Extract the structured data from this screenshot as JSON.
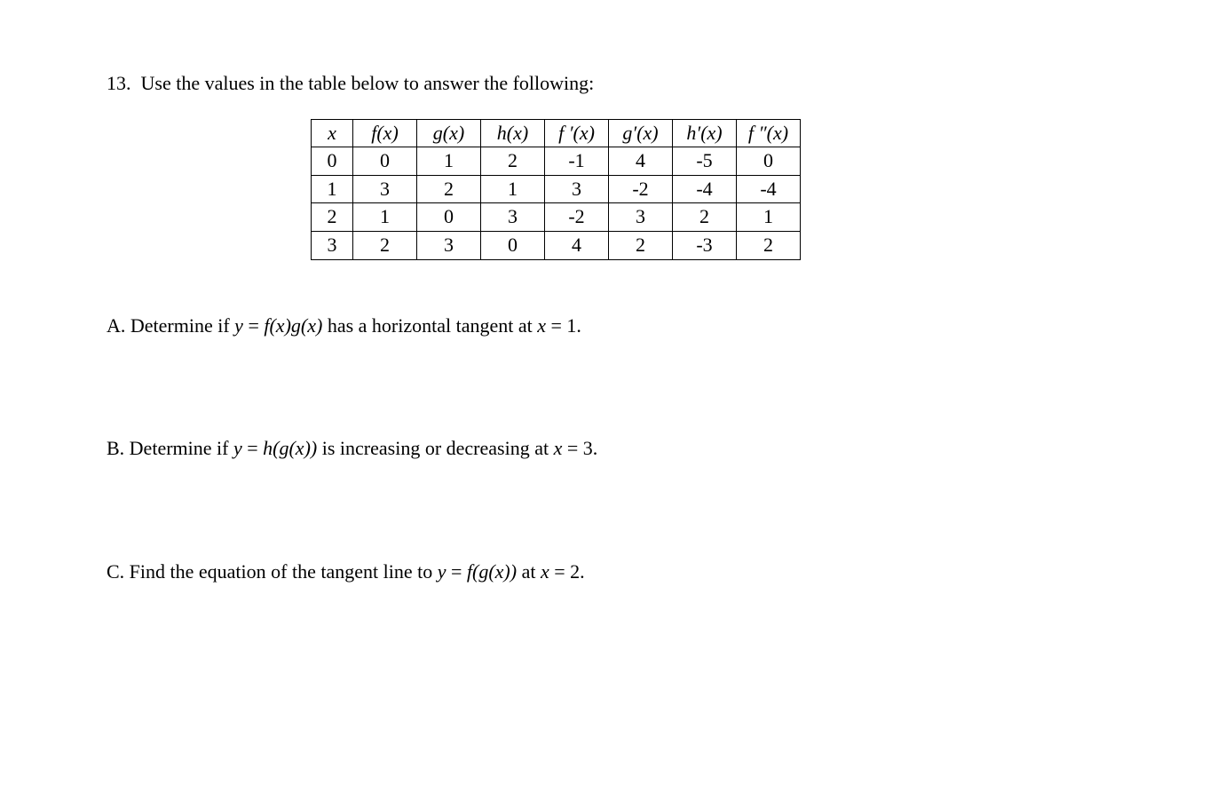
{
  "problem": {
    "number": "13.",
    "intro": "Use the values in the table below to answer the following:"
  },
  "table": {
    "headers": {
      "x": "x",
      "fx": "f(x)",
      "gx": "g(x)",
      "hx": "h(x)",
      "fpx": "f ′(x)",
      "gpx": "g′(x)",
      "hpx": "h′(x)",
      "fppx": "f ″(x)"
    },
    "rows": [
      {
        "x": "0",
        "fx": "0",
        "gx": "1",
        "hx": "2",
        "fpx": "-1",
        "gpx": "4",
        "hpx": "-5",
        "fppx": "0"
      },
      {
        "x": "1",
        "fx": "3",
        "gx": "2",
        "hx": "1",
        "fpx": "3",
        "gpx": "-2",
        "hpx": "-4",
        "fppx": "-4"
      },
      {
        "x": "2",
        "fx": "1",
        "gx": "0",
        "hx": "3",
        "fpx": "-2",
        "gpx": "3",
        "hpx": "2",
        "fppx": "1"
      },
      {
        "x": "3",
        "fx": "2",
        "gx": "3",
        "hx": "0",
        "fpx": "4",
        "gpx": "2",
        "hpx": "-3",
        "fppx": "2"
      }
    ]
  },
  "questions": {
    "a": {
      "label": "A. Determine if ",
      "expr_y": "y",
      "expr_eq": " = ",
      "expr_fn": "f(x)g(x)",
      "mid": " has a horizontal tangent at ",
      "expr_x": "x",
      "expr_val": " = 1",
      "end": "."
    },
    "b": {
      "label": "B. Determine if ",
      "expr_y": "y",
      "expr_eq": " = ",
      "expr_fn": "h(g(x))",
      "mid": " is increasing or decreasing at ",
      "expr_x": "x",
      "expr_val": " = 3",
      "end": "."
    },
    "c": {
      "label": "C. Find the equation of the tangent line to ",
      "expr_y": "y",
      "expr_eq": " = ",
      "expr_fn": "f(g(x))",
      "mid": " at ",
      "expr_x": "x",
      "expr_val": " = 2",
      "end": "."
    }
  }
}
